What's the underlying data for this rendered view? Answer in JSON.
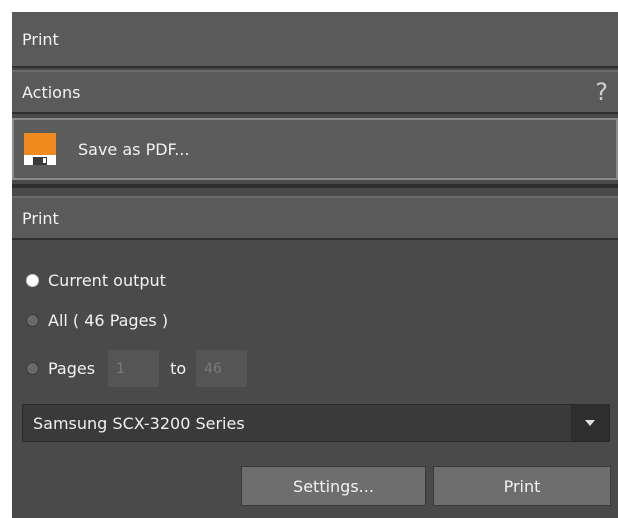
{
  "window": {
    "title": "Print"
  },
  "actions": {
    "title": "Actions",
    "help_label": "?",
    "save_pdf_label": "Save as PDF..."
  },
  "print_section": {
    "title": "Print",
    "options": [
      {
        "label": "Current output",
        "checked": true
      },
      {
        "label": "All ( 46 Pages )",
        "checked": false
      },
      {
        "label": "Pages",
        "checked": false
      }
    ],
    "page_from": "1",
    "to_label": "to",
    "page_to": "46",
    "printer": "Samsung SCX-3200 Series",
    "settings_label": "Settings...",
    "print_label": "Print"
  },
  "colors": {
    "panel": "#4a4a4a",
    "header": "#5a5a5a",
    "floppy": "#f08a1e"
  }
}
